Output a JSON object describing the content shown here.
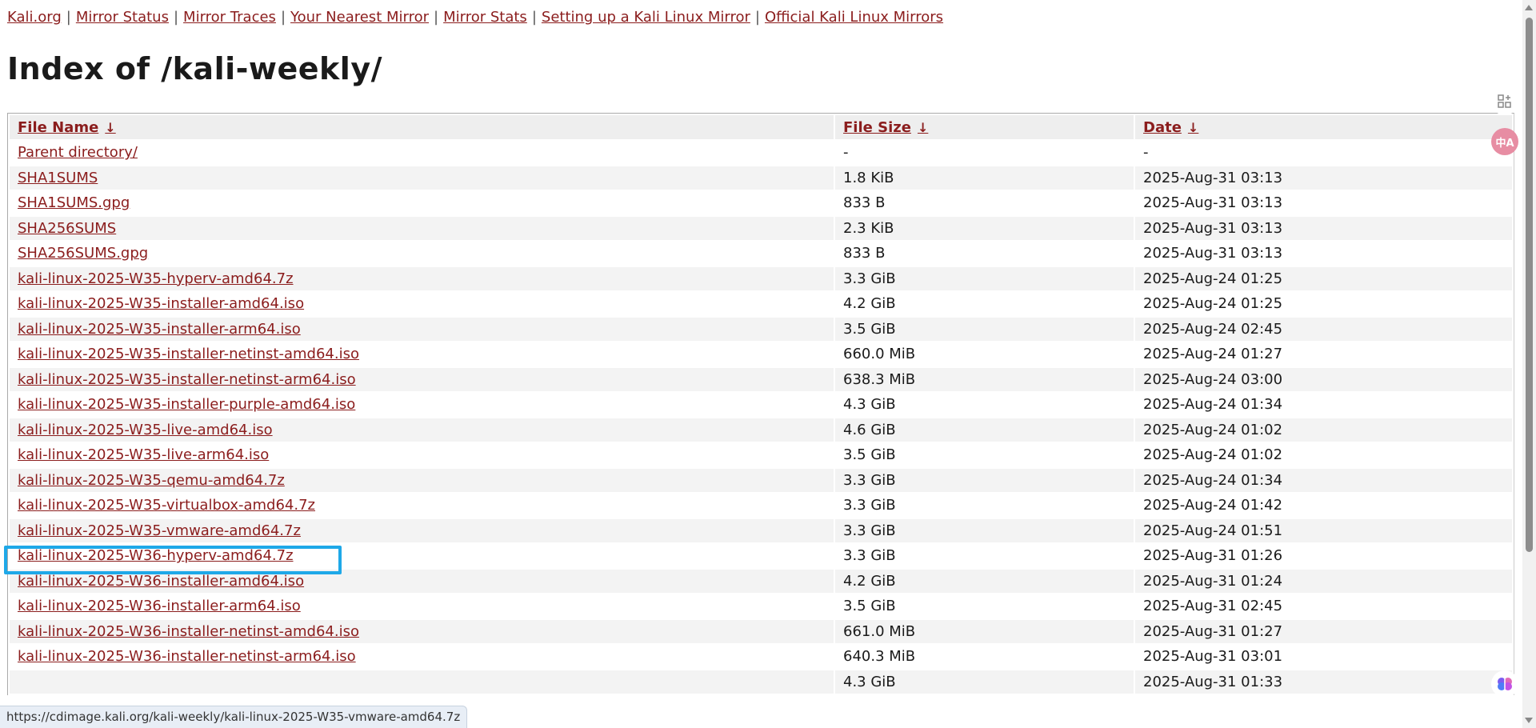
{
  "nav": {
    "links": [
      "Kali.org",
      "Mirror Status",
      "Mirror Traces",
      "Your Nearest Mirror",
      "Mirror Stats",
      "Setting up a Kali Linux Mirror",
      "Official Kali Linux Mirrors"
    ],
    "separator": "|"
  },
  "page": {
    "title": "Index of /kali-weekly/"
  },
  "table": {
    "headers": [
      "File Name",
      "File Size",
      "Date"
    ],
    "sort_arrow": "↓",
    "rows": [
      {
        "name": "Parent directory/",
        "size": "-",
        "date": "-"
      },
      {
        "name": "SHA1SUMS",
        "size": "1.8 KiB",
        "date": "2025-Aug-31 03:13"
      },
      {
        "name": "SHA1SUMS.gpg",
        "size": "833 B",
        "date": "2025-Aug-31 03:13"
      },
      {
        "name": "SHA256SUMS",
        "size": "2.3 KiB",
        "date": "2025-Aug-31 03:13"
      },
      {
        "name": "SHA256SUMS.gpg",
        "size": "833 B",
        "date": "2025-Aug-31 03:13"
      },
      {
        "name": "kali-linux-2025-W35-hyperv-amd64.7z",
        "size": "3.3 GiB",
        "date": "2025-Aug-24 01:25"
      },
      {
        "name": "kali-linux-2025-W35-installer-amd64.iso",
        "size": "4.2 GiB",
        "date": "2025-Aug-24 01:25"
      },
      {
        "name": "kali-linux-2025-W35-installer-arm64.iso",
        "size": "3.5 GiB",
        "date": "2025-Aug-24 02:45"
      },
      {
        "name": "kali-linux-2025-W35-installer-netinst-amd64.iso",
        "size": "660.0 MiB",
        "date": "2025-Aug-24 01:27"
      },
      {
        "name": "kali-linux-2025-W35-installer-netinst-arm64.iso",
        "size": "638.3 MiB",
        "date": "2025-Aug-24 03:00"
      },
      {
        "name": "kali-linux-2025-W35-installer-purple-amd64.iso",
        "size": "4.3 GiB",
        "date": "2025-Aug-24 01:34"
      },
      {
        "name": "kali-linux-2025-W35-live-amd64.iso",
        "size": "4.6 GiB",
        "date": "2025-Aug-24 01:02"
      },
      {
        "name": "kali-linux-2025-W35-live-arm64.iso",
        "size": "3.5 GiB",
        "date": "2025-Aug-24 01:02"
      },
      {
        "name": "kali-linux-2025-W35-qemu-amd64.7z",
        "size": "3.3 GiB",
        "date": "2025-Aug-24 01:34"
      },
      {
        "name": "kali-linux-2025-W35-virtualbox-amd64.7z",
        "size": "3.3 GiB",
        "date": "2025-Aug-24 01:42"
      },
      {
        "name": "kali-linux-2025-W35-vmware-amd64.7z",
        "size": "3.3 GiB",
        "date": "2025-Aug-24 01:51"
      },
      {
        "name": "kali-linux-2025-W36-hyperv-amd64.7z",
        "size": "3.3 GiB",
        "date": "2025-Aug-31 01:26"
      },
      {
        "name": "kali-linux-2025-W36-installer-amd64.iso",
        "size": "4.2 GiB",
        "date": "2025-Aug-31 01:24"
      },
      {
        "name": "kali-linux-2025-W36-installer-arm64.iso",
        "size": "3.5 GiB",
        "date": "2025-Aug-31 02:45"
      },
      {
        "name": "kali-linux-2025-W36-installer-netinst-amd64.iso",
        "size": "661.0 MiB",
        "date": "2025-Aug-31 01:27"
      },
      {
        "name": "kali-linux-2025-W36-installer-netinst-arm64.iso",
        "size": "640.3 MiB",
        "date": "2025-Aug-31 03:01"
      },
      {
        "name": "",
        "size": "4.3 GiB",
        "date": "2025-Aug-31 01:33"
      }
    ]
  },
  "status_bar": {
    "url": "https://cdimage.kali.org/kali-weekly/kali-linux-2025-W35-vmware-amd64.7z"
  },
  "side_buttons": {
    "translate_label": "中A"
  },
  "icons": [
    "apps-add-icon",
    "translate-icon",
    "brain-icon"
  ],
  "colors": {
    "link": "#8b1d1d",
    "highlight": "#1ea8e8",
    "translate_button": "#e78da3"
  }
}
